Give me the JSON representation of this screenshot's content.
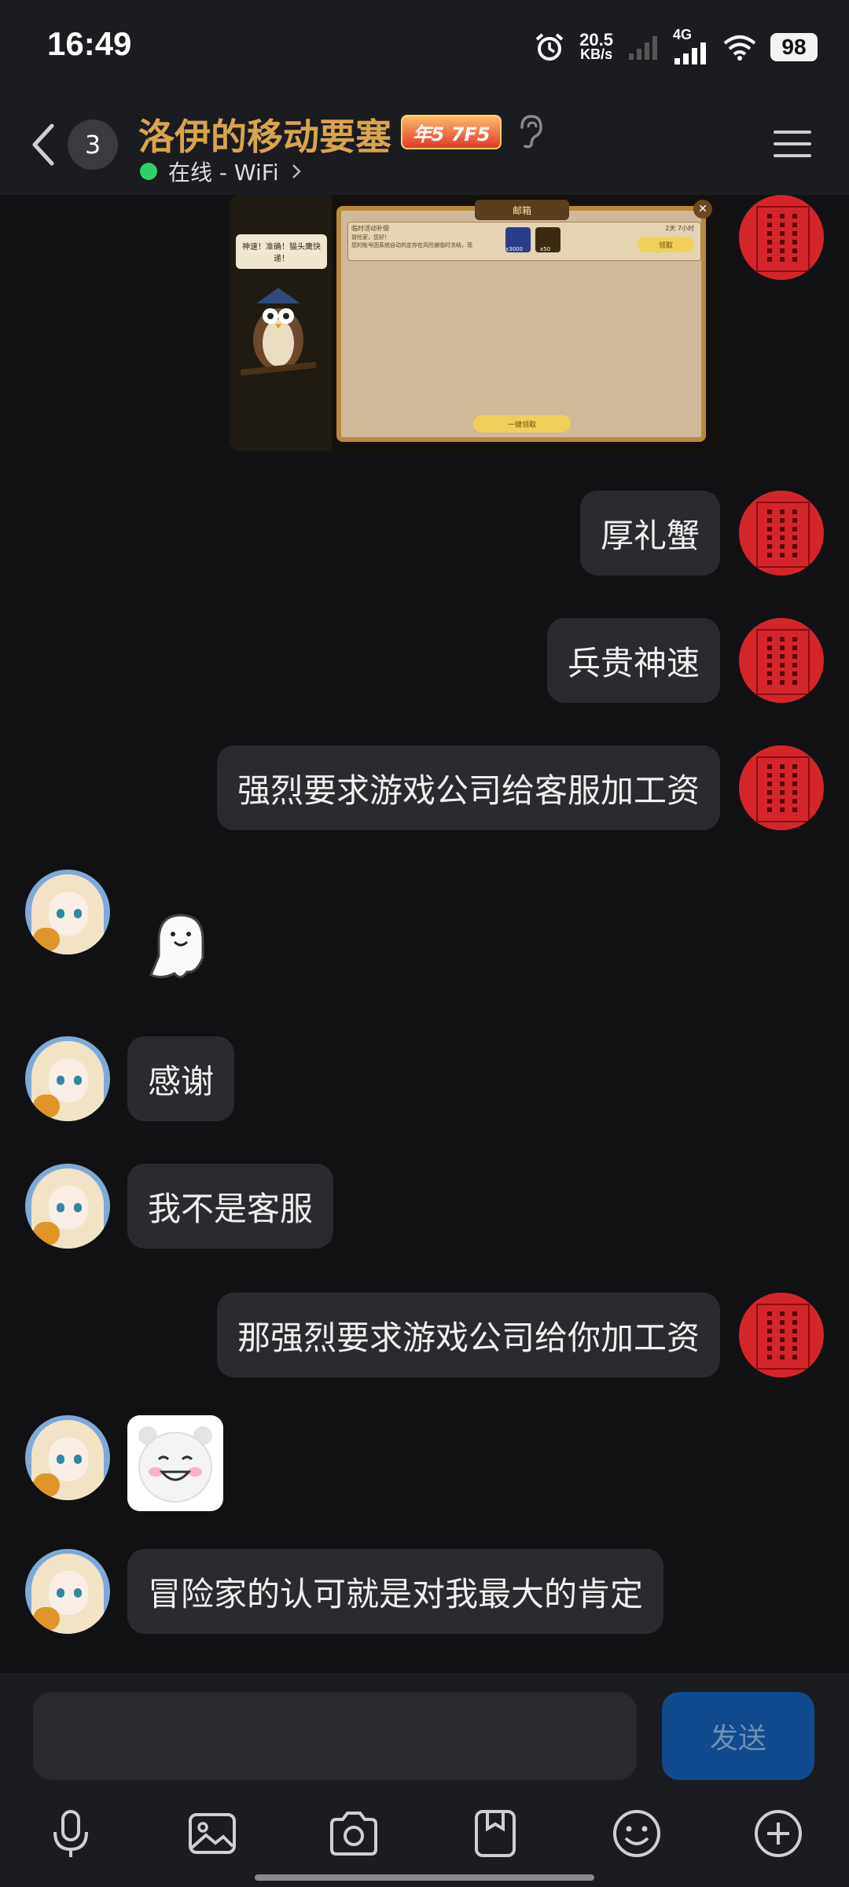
{
  "status_bar": {
    "time": "16:49",
    "net_speed": "20.5",
    "net_unit": "KB/s",
    "network_type": "4G",
    "battery": "98"
  },
  "header": {
    "unread_count": "3",
    "title": "洛伊的移动要塞",
    "level_badge": "年5 7F5",
    "status": "在线 - WiFi",
    "status_dot_color": "#2fd167",
    "title_color": "#d9a44e"
  },
  "screenshot": {
    "window_title": "邮箱",
    "owl_speech": "神速！准确！猫头鹰快递！",
    "mail_subject": "临时活动补偿",
    "mail_greeting": "冒险家，您好！",
    "mail_body": "您的账号因系统自动判定存在风险被临时冻结，现",
    "timer": "2天 7小时",
    "reward_1": "x3000",
    "reward_2": "x50",
    "claim_button": "领取",
    "claim_all_button": "一键领取"
  },
  "messages": [
    {
      "side": "me",
      "text": "厚礼蟹"
    },
    {
      "side": "me",
      "text": "兵贵神速"
    },
    {
      "side": "me",
      "text": "强烈要求游戏公司给客服加工资"
    },
    {
      "side": "them",
      "type": "sticker"
    },
    {
      "side": "them",
      "text": "感谢"
    },
    {
      "side": "them",
      "text": "我不是客服"
    },
    {
      "side": "me",
      "text": "那强烈要求游戏公司给你加工资"
    },
    {
      "side": "them",
      "type": "sticker"
    },
    {
      "side": "them",
      "text": "冒险家的认可就是对我最大的肯定"
    }
  ],
  "input": {
    "placeholder": "",
    "send_label": "发送"
  },
  "toolbar_icons": [
    "microphone-icon",
    "image-icon",
    "camera-icon",
    "file-icon",
    "emoji-icon",
    "plus-icon"
  ],
  "colors": {
    "background": "#111113",
    "bubble": "#2a2b2e",
    "send_button": "#0f4b8e",
    "avatar_red": "#d4262a"
  }
}
